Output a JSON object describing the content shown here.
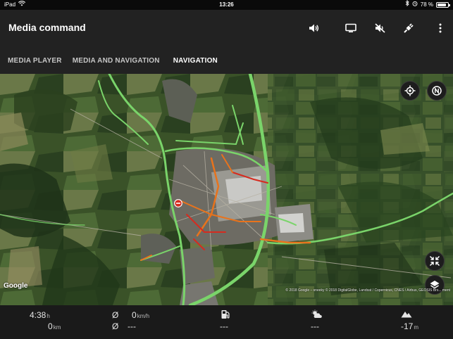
{
  "status_bar": {
    "device": "iPad",
    "time": "13:26",
    "battery_text": "78 %"
  },
  "header": {
    "title": "Media command"
  },
  "tabs": [
    {
      "label": "MEDIA PLAYER",
      "active": false
    },
    {
      "label": "MEDIA AND NAVIGATION",
      "active": false
    },
    {
      "label": "NAVIGATION",
      "active": true
    }
  ],
  "map": {
    "google_logo": "Google",
    "attribution": "© 2018 Google – sneeky © 2018 DigitalGlobe, Landsat / Copernicus, CNES / Airbus, GEOSIS Brs... ment"
  },
  "bottom_bar": {
    "time_value": "4:38",
    "time_unit": "h",
    "distance_value": "0",
    "distance_unit": "km",
    "avg_speed_symbol": "Ø",
    "avg_speed_value": "0",
    "avg_speed_unit": "km/h",
    "avg_consumption_symbol": "Ø",
    "avg_consumption_value": "---",
    "fuel_value": "---",
    "weather_value": "---",
    "altitude_value": "-17",
    "altitude_unit": "m"
  },
  "colors": {
    "header_bg": "#222222",
    "bottom_bg": "#1a1a1a",
    "route_green": "#7ad46a",
    "traffic_orange": "#e8731c",
    "traffic_red": "#d62b1f"
  }
}
